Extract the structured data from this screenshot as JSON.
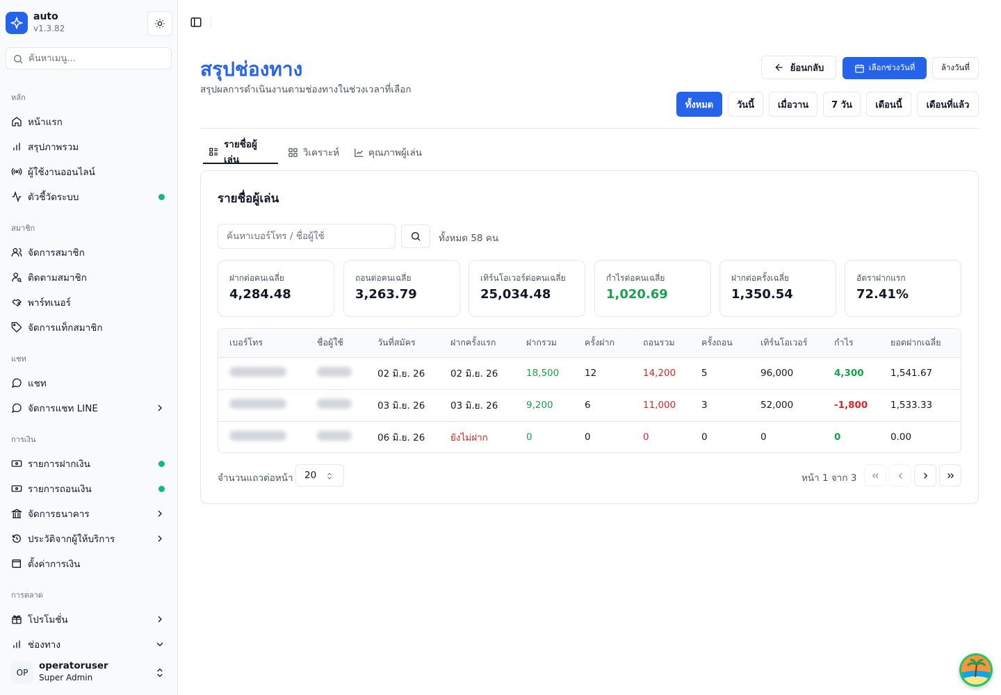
{
  "brand": {
    "name": "auto",
    "version": "v1.3.82",
    "logo_icon": "sparkle-icon",
    "theme_icon": "sun-icon"
  },
  "menu_search": {
    "placeholder": "ค้นหาเมนู..."
  },
  "sidebar": {
    "groups": [
      {
        "label": "หลัก",
        "items": [
          {
            "label": "หน้าแรก",
            "icon": "home-icon"
          },
          {
            "label": "สรุปภาพรวม",
            "icon": "bar-chart-icon"
          },
          {
            "label": "ผู้ใช้งานออนไลน์",
            "icon": "radio-icon"
          },
          {
            "label": "ตัวชี้วัดระบบ",
            "icon": "activity-icon",
            "dot": true
          }
        ]
      },
      {
        "label": "สมาชิก",
        "items": [
          {
            "label": "จัดการสมาชิก",
            "icon": "users-icon"
          },
          {
            "label": "ติดตามสมาชิก",
            "icon": "user-search-icon"
          },
          {
            "label": "พาร์ทเนอร์",
            "icon": "handshake-icon"
          },
          {
            "label": "จัดการแท็กสมาชิก",
            "icon": "tag-icon"
          }
        ]
      },
      {
        "label": "แชท",
        "items": [
          {
            "label": "แชท",
            "icon": "chat-icon"
          },
          {
            "label": "จัดการแชท LINE",
            "icon": "chat-icon",
            "chevron": "right"
          }
        ]
      },
      {
        "label": "การเงิน",
        "items": [
          {
            "label": "รายการฝากเงิน",
            "icon": "deposit-icon",
            "dot": true
          },
          {
            "label": "รายการถอนเงิน",
            "icon": "withdraw-icon",
            "dot": true
          },
          {
            "label": "จัดการธนาคาร",
            "icon": "bank-icon",
            "chevron": "right"
          },
          {
            "label": "ประวัติจากผู้ให้บริการ",
            "icon": "history-icon",
            "chevron": "right"
          },
          {
            "label": "ตั้งค่าการเงิน",
            "icon": "wallet-icon"
          }
        ]
      },
      {
        "label": "การตลาด",
        "items": [
          {
            "label": "โปรโมชั่น",
            "icon": "gift-icon",
            "chevron": "right"
          },
          {
            "label": "ช่องทาง",
            "icon": "bar-chart-icon",
            "chevron": "down"
          }
        ]
      }
    ]
  },
  "user": {
    "initials": "OP",
    "name": "operatoruser",
    "role": "Super Admin"
  },
  "page": {
    "title": "สรุปช่องทาง",
    "subtitle": "สรุปผลการดำเนินงานตามช่องทางในช่วงเวลาที่เลือก",
    "back_label": "ย้อนกลับ",
    "pick_date_label": "เลือกช่วงวันที่",
    "clear_date_label": "ล้างวันที่",
    "ranges": [
      "ทั้งหมด",
      "วันนี้",
      "เมื่อวาน",
      "7 วัน",
      "เดือนนี้",
      "เดือนที่แล้ว"
    ],
    "active_range": "ทั้งหมด"
  },
  "tabs": [
    {
      "label": "รายชื่อผู้เล่น",
      "icon": "list-icon",
      "active": true
    },
    {
      "label": "วิเคราะห์",
      "icon": "grid-icon",
      "active": false
    },
    {
      "label": "คุณภาพผู้เล่น",
      "icon": "line-chart-icon",
      "active": false
    }
  ],
  "panel": {
    "title": "รายชื่อผู้เล่น",
    "search_placeholder": "ค้นหาเบอร์โทร / ชื่อผู้ใช้",
    "total": "ทั้งหมด 58 คน",
    "stats": [
      {
        "label": "ฝากต่อคนเฉลี่ย",
        "value": "4,284.48",
        "color": "#111827"
      },
      {
        "label": "ถอนต่อคนเฉลี่ย",
        "value": "3,263.79",
        "color": "#111827"
      },
      {
        "label": "เทิร์นโอเวอร์ต่อคนเฉลี่ย",
        "value": "25,034.48",
        "color": "#111827"
      },
      {
        "label": "กำไรต่อคนเฉลี่ย",
        "value": "1,020.69",
        "color": "#16a34a"
      },
      {
        "label": "ฝากต่อครั้งเฉลี่ย",
        "value": "1,350.54",
        "color": "#111827"
      },
      {
        "label": "อัตราฝากแรก",
        "value": "72.41%",
        "color": "#111827"
      }
    ],
    "table": {
      "headers": [
        "เบอร์โทร",
        "ชื่อผู้ใช้",
        "วันที่สมัคร",
        "ฝากครั้งแรก",
        "ฝากรวม",
        "ครั้งฝาก",
        "ถอนรวม",
        "ครั้งถอน",
        "เทิร์นโอเวอร์",
        "กำไร",
        "ยอดฝากเฉลี่ย"
      ],
      "rows": [
        {
          "register": "02 มิ.ย. 26",
          "first_deposit": "02 มิ.ย. 26",
          "deposit_total": "18,500",
          "deposit_count": "12",
          "withdraw_total": "14,200",
          "withdraw_count": "5",
          "turnover": "96,000",
          "profit": "4,300",
          "avg_deposit": "1,541.67"
        },
        {
          "register": "03 มิ.ย. 26",
          "first_deposit": "03 มิ.ย. 26",
          "deposit_total": "9,200",
          "deposit_count": "6",
          "withdraw_total": "11,000",
          "withdraw_count": "3",
          "turnover": "52,000",
          "profit": "-1,800",
          "avg_deposit": "1,533.33"
        },
        {
          "register": "06 มิ.ย. 26",
          "first_deposit": "ยังไม่ฝาก",
          "deposit_total": "0",
          "deposit_count": "0",
          "withdraw_total": "0",
          "withdraw_count": "0",
          "turnover": "0",
          "profit": "0",
          "avg_deposit": "0.00"
        }
      ]
    },
    "rows_per_page_label": "จำนวนแถวต่อหน้า",
    "rows_per_page": "20",
    "page_info": "หน้า 1 จาก 3"
  }
}
